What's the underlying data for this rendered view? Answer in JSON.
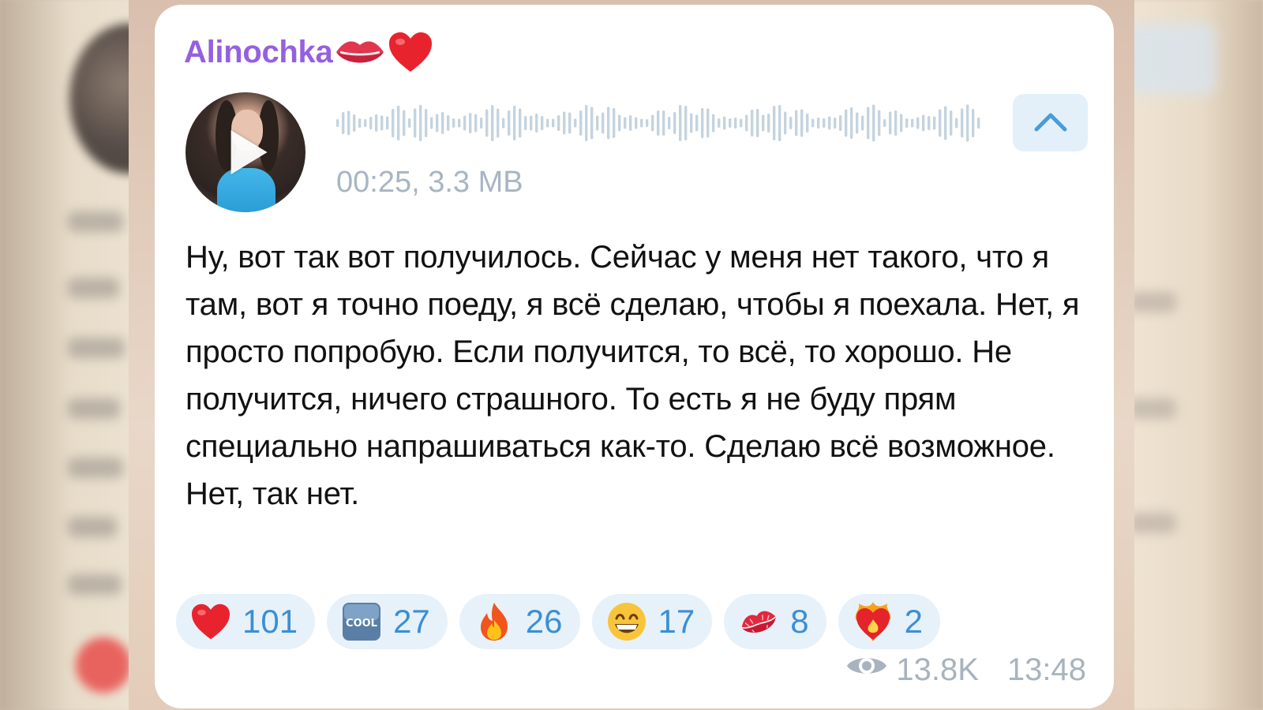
{
  "sender": {
    "name": "Alinochka",
    "emoji_icons": [
      "lips-icon",
      "red-heart-icon"
    ]
  },
  "voice_message": {
    "duration": "00:25",
    "size": "3.3 MB",
    "meta_text": "00:25, 3.3 MB",
    "thumbnail_overlay_icon": "play-icon",
    "collapse_icon": "chevron-up-icon"
  },
  "transcript": "Ну, вот так вот получилось. Сейчас у меня нет такого, что я там, вот я точно поеду, я всё сделаю, чтобы я поехала. Нет, я просто попробую. Если получится, то всё, то хорошо. Не получится, ничего страшного. То есть я не буду прям специально напрашиваться как-то. Сделаю всё возможное. Нет, так нет.",
  "reactions": [
    {
      "icon": "red-heart-icon",
      "count": "101"
    },
    {
      "icon": "cool-icon",
      "count": "27"
    },
    {
      "icon": "fire-icon",
      "count": "26"
    },
    {
      "icon": "grinning-face-icon",
      "count": "17"
    },
    {
      "icon": "kiss-mark-icon",
      "count": "8"
    },
    {
      "icon": "heart-on-fire-icon",
      "count": "2"
    }
  ],
  "footer": {
    "views": "13.8K",
    "time": "13:48",
    "views_icon": "eye-icon"
  },
  "colors": {
    "sender_name": "#9560e0",
    "meta_text": "#a8b5c2",
    "reaction_bg": "#e7f1fa",
    "reaction_count": "#3b8fd4",
    "accent": "#3b8fd4"
  }
}
